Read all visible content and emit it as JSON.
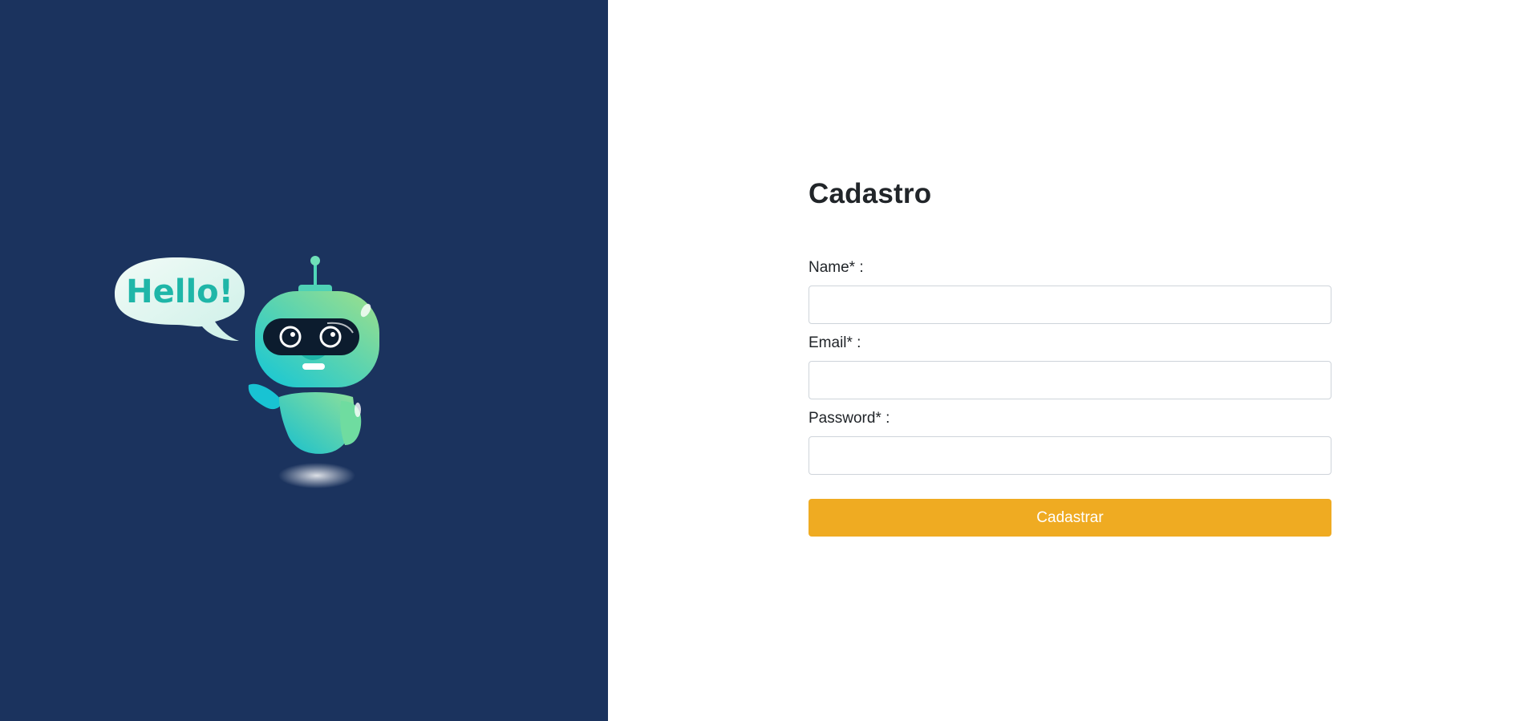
{
  "illustration": {
    "speech_bubble_text": "Hello!",
    "colors": {
      "panel_background": "#1b335e",
      "robot_body": "#2ad0c6",
      "bubble": "#dff7ef"
    }
  },
  "form": {
    "title": "Cadastro",
    "fields": [
      {
        "label": "Name* :",
        "value": "",
        "placeholder": ""
      },
      {
        "label": "Email* :",
        "value": "",
        "placeholder": ""
      },
      {
        "label": "Password* :",
        "value": "",
        "placeholder": ""
      }
    ],
    "submit_label": "Cadastrar",
    "submit_color": "#efab22"
  }
}
